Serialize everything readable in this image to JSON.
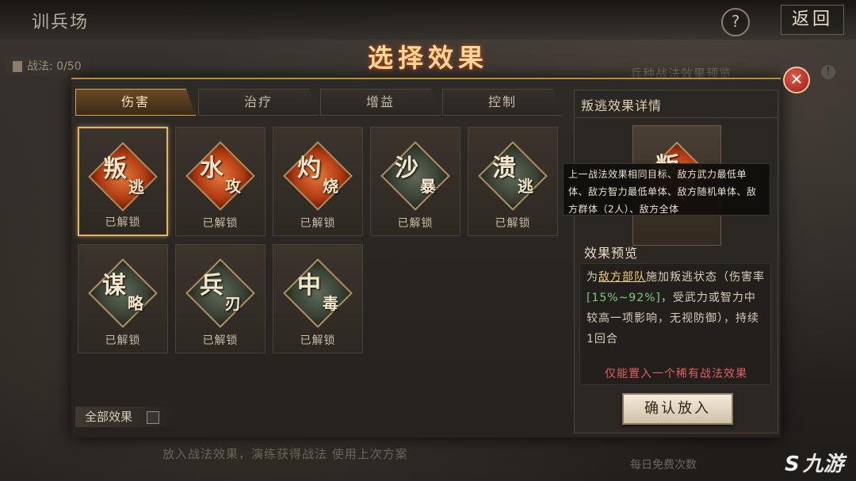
{
  "header": {
    "title": "训兵场",
    "help_label": "?",
    "back_label": "返回"
  },
  "background": {
    "battle_count": "战法: 0/50",
    "preview_label": "兵种战法效果预览",
    "bottom_hint": "放入战法效果，演练获得战法  使用上次方案",
    "bottom_right": "每日免费次数"
  },
  "modal": {
    "title": "选择效果",
    "close_label": "✕",
    "tabs": [
      {
        "label": "伤害",
        "active": true
      },
      {
        "label": "治疗",
        "active": false
      },
      {
        "label": "增益",
        "active": false
      },
      {
        "label": "控制",
        "active": false
      }
    ],
    "cards": [
      {
        "c1": "叛",
        "c2": "逃",
        "style": "red",
        "status": "已解锁",
        "selected": true
      },
      {
        "c1": "水",
        "c2": "攻",
        "style": "red",
        "status": "已解锁",
        "selected": false
      },
      {
        "c1": "灼",
        "c2": "烧",
        "style": "red",
        "status": "已解锁",
        "selected": false
      },
      {
        "c1": "沙",
        "c2": "暴",
        "style": "green",
        "status": "已解锁",
        "selected": false
      },
      {
        "c1": "溃",
        "c2": "逃",
        "style": "green",
        "status": "已解锁",
        "selected": false
      },
      {
        "c1": "谋",
        "c2": "略",
        "style": "green",
        "status": "已解锁",
        "selected": false
      },
      {
        "c1": "兵",
        "c2": "刃",
        "style": "green",
        "status": "已解锁",
        "selected": false
      },
      {
        "c1": "中",
        "c2": "毒",
        "style": "green",
        "status": "已解锁",
        "selected": false
      }
    ],
    "all_effects_label": "全部效果"
  },
  "detail": {
    "title": "叛逃效果详情",
    "emblem_c1": "叛",
    "emblem_c2": "逃",
    "tooltip": "上一战法效果相同目标、敌方武力最低单体、敌方智力最低单体、敌方随机单体、敌方群体（2人）、敌方全体",
    "preview_label": "效果预览",
    "preview": {
      "p1": "为",
      "target": "敌方部队",
      "p2": "施加叛逃状态（伤害率",
      "rate": "[15%~92%]",
      "p3": "，受武力或智力中较高一项影响，无视防御），持续1回合"
    },
    "warning": "仅能置入一个稀有战法效果",
    "confirm_label": "确认放入"
  },
  "watermark": {
    "mark": "S",
    "text": "九游"
  },
  "colors": {
    "accent_gold": "#e3b767",
    "title_orange": "#ffd89a",
    "warning_red": "#e06060",
    "highlight_yellow": "#f0d070",
    "highlight_green": "#7ad07a"
  }
}
